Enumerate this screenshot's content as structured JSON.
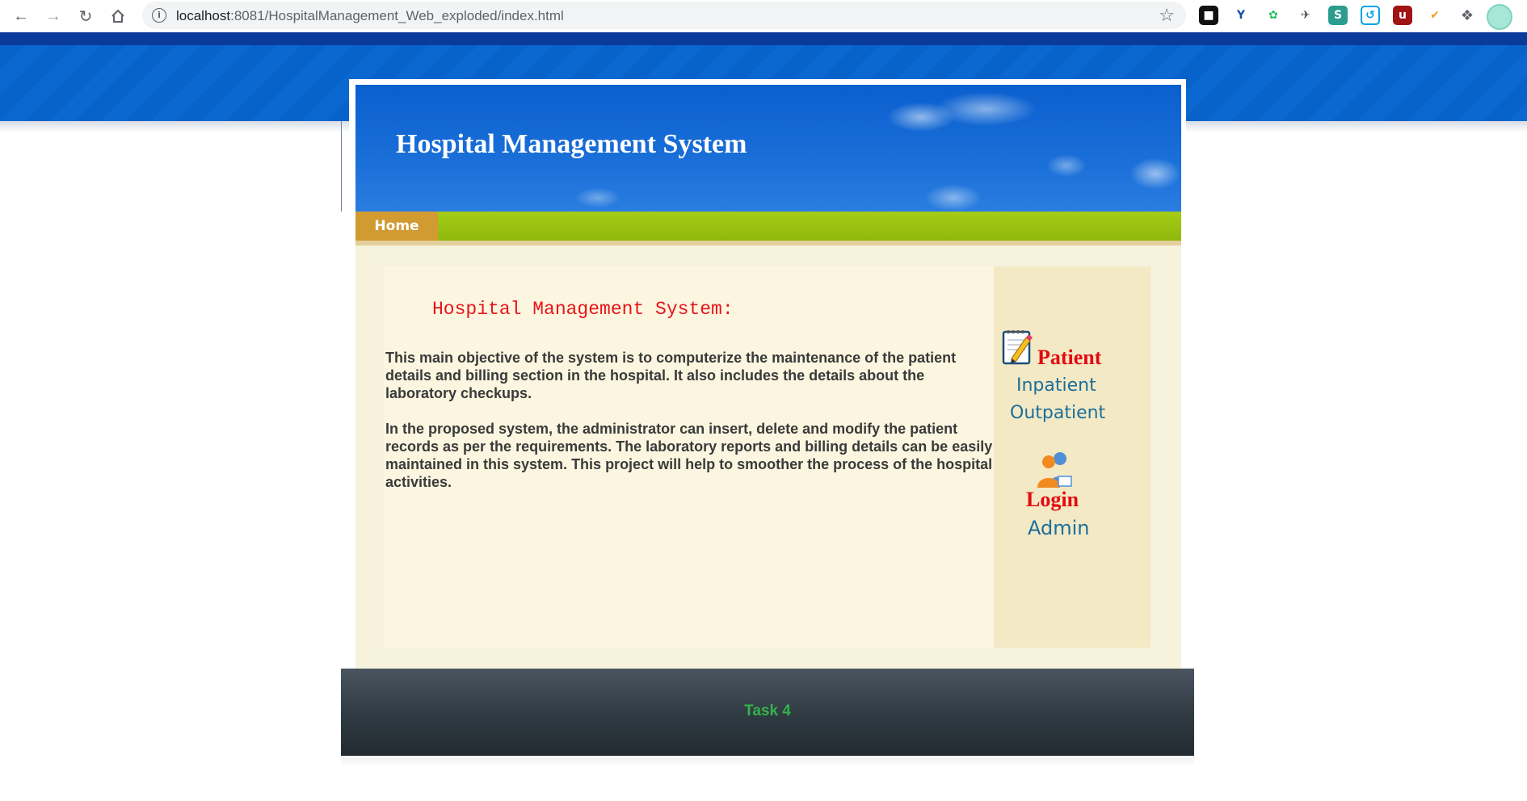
{
  "browser": {
    "url_host": "localhost",
    "url_rest": ":8081/HospitalManagement_Web_exploded/index.html",
    "back_icon": "arrow-left-icon",
    "forward_icon": "arrow-right-icon",
    "reload_icon": "reload-icon",
    "home_icon": "home-icon"
  },
  "header": {
    "title": "Hospital Management System"
  },
  "menu": {
    "home_label": "Home"
  },
  "main": {
    "heading": "Hospital Management System:",
    "paragraph1": "This main objective of the system is to computerize the maintenance of the patient details and billing section in the hospital. It also includes the details about the laboratory checkups.",
    "paragraph2": "In the proposed system, the administrator can insert, delete and modify the patient records as per the requirements. The laboratory reports and billing details can be easily maintained in this system. This project will help to smoother the process of the hospital activities."
  },
  "sidebar": {
    "patient_label": "Patient",
    "inpatient_link": "Inpatient",
    "outpatient_link": "Outpatient",
    "login_label": "Login",
    "admin_link": "Admin"
  },
  "footer": {
    "text": "Task 4"
  },
  "colors": {
    "header_blue": "#0762c9",
    "menu_green": "#9fc510",
    "menu_home": "#d19b32",
    "heading_red": "#e8141a",
    "link_blue": "#1c6f9a",
    "footer_text": "#35b24a"
  }
}
